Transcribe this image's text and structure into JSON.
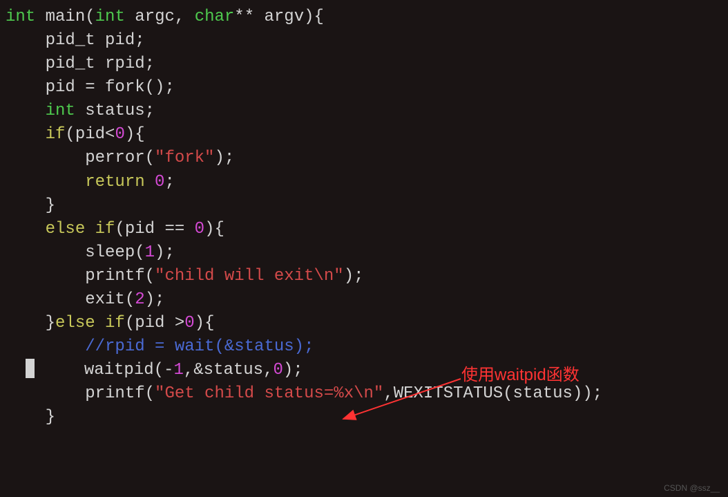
{
  "code": {
    "line1_int": "int",
    "line1_main": " main(",
    "line1_int2": "int",
    "line1_argc": " argc, ",
    "line1_char": "char",
    "line1_argv": "** argv){",
    "line2": "",
    "line3": "    pid_t pid;",
    "line4": "    pid_t rpid;",
    "line5a": "    pid = fork();",
    "line6a": "    ",
    "line6_int": "int",
    "line6b": " status;",
    "line7a": "    ",
    "line7_if": "if",
    "line7b": "(pid<",
    "line7_zero": "0",
    "line7c": "){",
    "line8a": "        perror(",
    "line8_str": "\"fork\"",
    "line8b": ");",
    "line9a": "        ",
    "line9_ret": "return",
    "line9b": " ",
    "line9_zero": "0",
    "line9c": ";",
    "line10": "    }",
    "line11a": "    ",
    "line11_else": "else",
    "line11b": " ",
    "line11_if": "if",
    "line11c": "(pid == ",
    "line11_zero": "0",
    "line11d": "){",
    "line12a": "        sleep(",
    "line12_one": "1",
    "line12b": ");",
    "line13a": "        printf(",
    "line13_str": "\"child will exit\\n\"",
    "line13b": ");",
    "line14a": "        exit(",
    "line14_two": "2",
    "line14b": ");",
    "line15": "",
    "line16a": "    }",
    "line16_else": "else",
    "line16b": " ",
    "line16_if": "if",
    "line16c": "(pid >",
    "line16_zero": "0",
    "line16d": "){",
    "line17a": "        ",
    "line17_comment": "//rpid = wait(&status);",
    "line18a": "        waitpid(-",
    "line18_one": "1",
    "line18b": ",&status,",
    "line18_zero": "0",
    "line18c": ");",
    "line19a": "        printf(",
    "line19_str": "\"Get child status=%x\\n\"",
    "line19b": ",WEXITSTATUS(status));",
    "line20": "    }"
  },
  "annotation": {
    "text": "使用waitpid函数"
  },
  "watermark": "CSDN @ssz__"
}
